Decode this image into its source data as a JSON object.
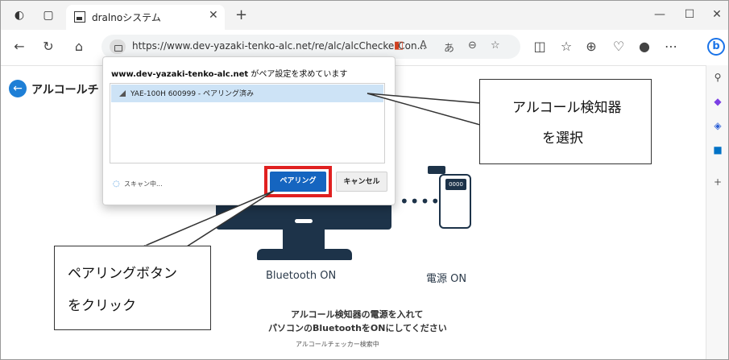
{
  "browser": {
    "tab_title": "dralnoシステム",
    "url": "https://www.dev-yazaki-tenko-alc.net/re/alc/alcCheckerCon..."
  },
  "page": {
    "title": "アルコールチ",
    "bluetooth_label": "Bluetooth ON",
    "power_label": "電源 ON",
    "checker_screen": "0000",
    "instruction_line1": "アルコール検知器の電源を入れて",
    "instruction_line2": "パソコンのBluetoothをONにしてください",
    "searching": "アルコールチェッカー検索中"
  },
  "dialog": {
    "host": "www.dev-yazaki-tenko-alc.net",
    "title_suffix": " がペア設定を求めています",
    "device": "YAE-100H  600999 - ペアリング済み",
    "scanning": "スキャン中...",
    "pair_label": "ペアリング",
    "cancel_label": "キャンセル"
  },
  "callouts": {
    "select_line1": "アルコール検知器",
    "select_line2": "を選択",
    "pair_line1": "ペアリングボタン",
    "pair_line2": "をクリック"
  },
  "colors": {
    "accent": "#1565c0",
    "highlight": "#e02020",
    "illustration": "#1d3349"
  }
}
